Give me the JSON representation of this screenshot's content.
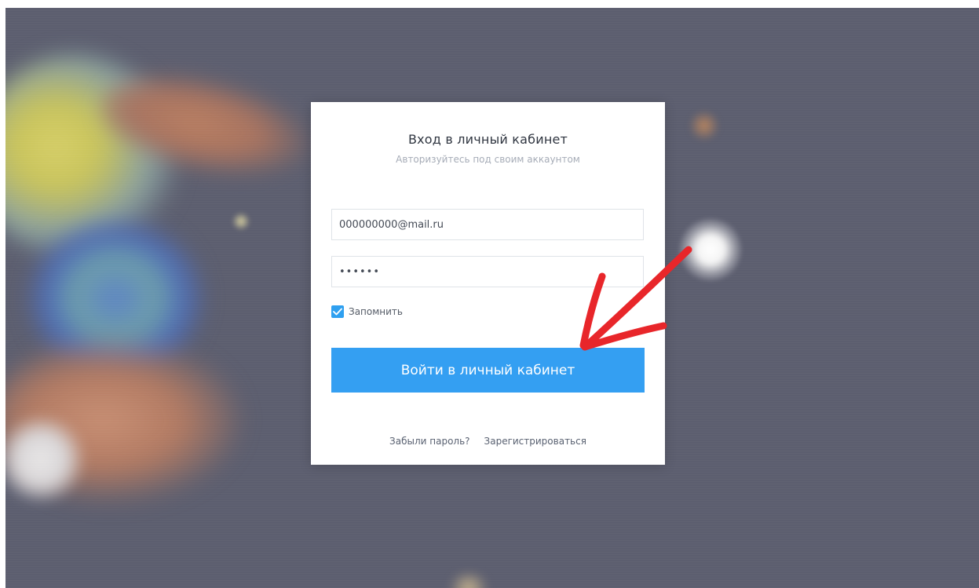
{
  "login": {
    "title": "Вход в личный кабинет",
    "subtitle": "Авторизуйтесь под своим аккаунтом",
    "email_value": "000000000@mail.ru",
    "password_value": "••••••",
    "remember_label": "Запомнить",
    "remember_checked": true,
    "submit_label": "Войти в личный кабинет",
    "forgot_link": "Забыли пароль?",
    "register_link": "Зарегистрироваться"
  },
  "colors": {
    "background": "#5c5e6f",
    "accent": "#349ff2",
    "annotation": "#e8262a"
  },
  "icons": {
    "checkbox": "checkmark-icon",
    "annotation": "red-arrow"
  }
}
